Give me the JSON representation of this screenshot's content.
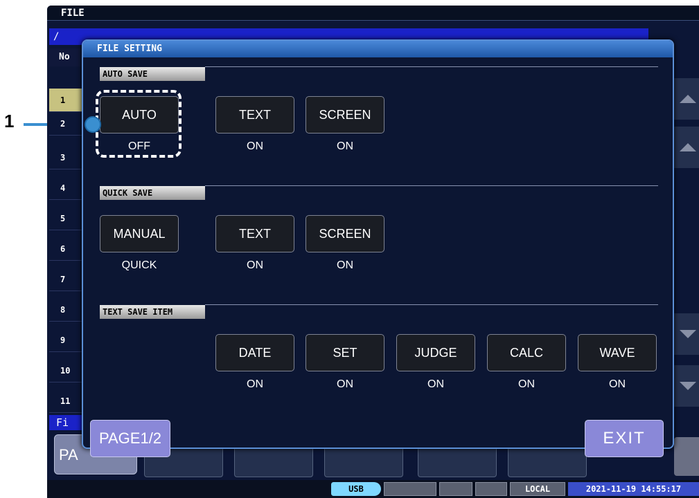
{
  "callout": {
    "number": "1"
  },
  "screen": {
    "title": "FILE",
    "path": "/",
    "list_header": "No",
    "row_numbers": [
      "1",
      "2",
      "3",
      "4",
      "5",
      "6",
      "7",
      "8",
      "9",
      "10",
      "11"
    ],
    "footer_label": "Fi",
    "page_button_partial": "PA"
  },
  "dialog": {
    "title": "FILE SETTING",
    "auto_save": {
      "label": "AUTO SAVE",
      "buttons": [
        {
          "label": "AUTO",
          "value": "OFF"
        },
        {
          "label": "TEXT",
          "value": "ON"
        },
        {
          "label": "SCREEN",
          "value": "ON"
        }
      ]
    },
    "quick_save": {
      "label": "QUICK SAVE",
      "buttons": [
        {
          "label": "MANUAL",
          "value": "QUICK"
        },
        {
          "label": "TEXT",
          "value": "ON"
        },
        {
          "label": "SCREEN",
          "value": "ON"
        }
      ]
    },
    "text_save_item": {
      "label": "TEXT SAVE ITEM",
      "buttons": [
        {
          "label": "DATE",
          "value": "ON"
        },
        {
          "label": "SET",
          "value": "ON"
        },
        {
          "label": "JUDGE",
          "value": "ON"
        },
        {
          "label": "CALC",
          "value": "ON"
        },
        {
          "label": "WAVE",
          "value": "ON"
        }
      ]
    },
    "page_button": "PAGE1/2",
    "exit_button": "EXIT"
  },
  "status_bar": {
    "usb": "USB",
    "local": "LOCAL",
    "datetime": "2021-11-19 14:55:17"
  },
  "colors": {
    "screen_bg": "#0c1636",
    "dialog_border": "#5b8fd6",
    "callout": "#3a8fd0",
    "selected_row": "#c7c280",
    "accent_button": "#8a88d8"
  }
}
